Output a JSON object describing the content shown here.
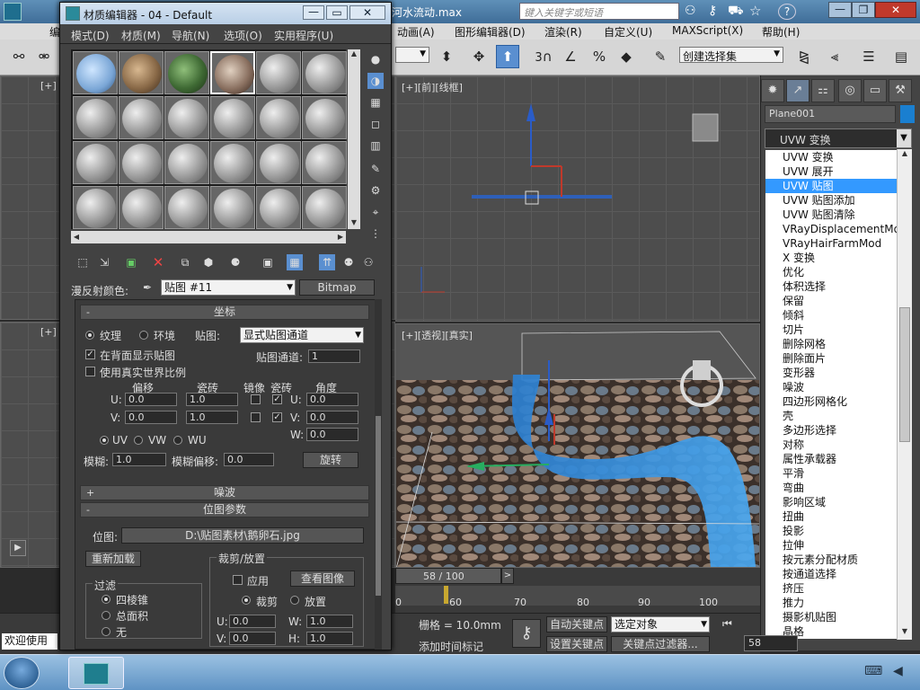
{
  "app": {
    "title_fragment": "河水流动.max",
    "search_placeholder": "键入关键字或短语"
  },
  "menubar": {
    "items": [
      "编",
      "动画(A)",
      "图形编辑器(D)",
      "渲染(R)",
      "自定义(U)",
      "MAXScript(X)",
      "帮助(H)"
    ]
  },
  "toolbar": {
    "num_label": "3",
    "selection_set_placeholder": "创建选择集"
  },
  "viewports": {
    "top_left": "[+]",
    "front": "[+][前][线框]",
    "left": "[+]",
    "persp": "[+][透视][真实]"
  },
  "material_editor": {
    "title": "材质编辑器 - 04 - Default",
    "menu": [
      "模式(D)",
      "材质(M)",
      "导航(N)",
      "选项(O)",
      "实用程序(U)"
    ],
    "diffuse_label": "漫反射颜色:",
    "map_name": "贴图 #11",
    "map_type": "Bitmap",
    "coords": {
      "header": "坐标",
      "texture": "纹理",
      "environ": "环境",
      "mapping_label": "贴图:",
      "mapping_value": "显式贴图通道",
      "show_on_back": "在背面显示贴图",
      "map_channel_label": "贴图通道:",
      "map_channel_value": "1",
      "real_world": "使用真实世界比例",
      "offset": "偏移",
      "tiling": "瓷砖",
      "mirror": "镜像",
      "tile": "瓷砖",
      "angle": "角度",
      "u": "U:",
      "v": "V:",
      "w": "W:",
      "u_offset": "0.0",
      "v_offset": "0.0",
      "u_tiling": "1.0",
      "v_tiling": "1.0",
      "u_angle": "0.0",
      "v_angle": "0.0",
      "w_angle": "0.0",
      "uv": "UV",
      "vw": "VW",
      "wu": "WU",
      "blur_label": "模糊:",
      "blur_value": "1.0",
      "blur_offset_label": "模糊偏移:",
      "blur_offset_value": "0.0",
      "rotate_btn": "旋转"
    },
    "noise_header": "噪波",
    "bitmap_params": {
      "header": "位图参数",
      "bitmap_label": "位图:",
      "bitmap_path": "D:\\贴图素材\\鹅卵石.jpg",
      "reload": "重新加载",
      "crop_group": "裁剪/放置",
      "apply": "应用",
      "view_image": "查看图像",
      "crop": "裁剪",
      "place": "放置",
      "filter_group": "过滤",
      "f1": "四棱锥",
      "f2": "总面积",
      "f3": "无",
      "u": "U:",
      "v": "V:",
      "w": "W:",
      "h": "H:",
      "u_val": "0.0",
      "v_val": "0.0",
      "w_val": "1.0",
      "h_val": "1.0"
    }
  },
  "command_panel": {
    "object_name": "Plane001",
    "object_color": "#1a7fd0",
    "modifier_selected": "UVW 变换",
    "modifier_list": [
      "UVW 变换",
      "UVW 展开",
      "UVW 贴图",
      "UVW 贴图添加",
      "UVW 贴图清除",
      "VRayDisplacementMod",
      "VRayHairFarmMod",
      "X 变换",
      "优化",
      "体积选择",
      "保留",
      "倾斜",
      "切片",
      "删除网格",
      "删除面片",
      "变形器",
      "噪波",
      "四边形网格化",
      "壳",
      "多边形选择",
      "对称",
      "属性承载器",
      "平滑",
      "弯曲",
      "影响区域",
      "扭曲",
      "投影",
      "拉伸",
      "按元素分配材质",
      "按通道选择",
      "挤压",
      "推力",
      "摄影机贴图",
      "晶格"
    ],
    "highlighted_index": 2
  },
  "timeline": {
    "frame": "58 / 100",
    "ticks": [
      "0",
      "60",
      "70",
      "80",
      "90",
      "100"
    ]
  },
  "status": {
    "welcome": "欢迎使用",
    "grid": "栅格 = 10.0mm",
    "add_time_tag": "添加时间标记",
    "auto_key": "自动关键点",
    "set_key": "设置关键点",
    "selected_obj": "选定对象",
    "key_filters": "关键点过滤器...",
    "frame_field": "58"
  }
}
